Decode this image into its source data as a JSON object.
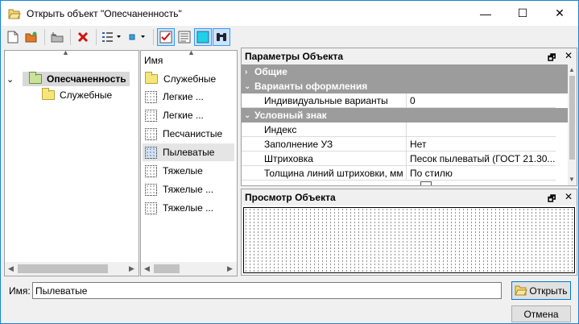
{
  "window": {
    "title": "Открыть объект \"Опесчаненность\"",
    "minimize_glyph": "—",
    "maximize_glyph": "☐",
    "close_glyph": "✕"
  },
  "toolbar": {
    "buttons": [
      {
        "name": "new-doc-icon"
      },
      {
        "name": "open-folder-icon"
      },
      {
        "name": "back-folder-icon"
      },
      {
        "name": "delete-icon"
      },
      {
        "name": "view-list-icon"
      },
      {
        "name": "view-small-icon"
      },
      {
        "name": "checked-icon"
      },
      {
        "name": "properties-icon"
      },
      {
        "name": "preview-icon"
      },
      {
        "name": "binoculars-icon"
      }
    ]
  },
  "tree": {
    "root": "Опесчаненность",
    "child": "Служебные",
    "expander": "⌄"
  },
  "list": {
    "header": "Имя",
    "items": [
      {
        "label": "Служебные",
        "type": "folder"
      },
      {
        "label": "Легкие ...",
        "type": "pattern"
      },
      {
        "label": "Легкие ...",
        "type": "pattern"
      },
      {
        "label": "Песчанистые",
        "type": "pattern"
      },
      {
        "label": "Пылеватые",
        "type": "pattern-selected"
      },
      {
        "label": "Тяжелые",
        "type": "pattern"
      },
      {
        "label": "Тяжелые ...",
        "type": "pattern"
      },
      {
        "label": "Тяжелые ...",
        "type": "pattern"
      }
    ]
  },
  "properties": {
    "title": "Параметры Объекта",
    "categories": {
      "general": "Общие",
      "variants": "Варианты оформления",
      "symbol": "Условный знак"
    },
    "rows": {
      "individual": {
        "key": "Индивидуальные варианты",
        "value": "0"
      },
      "index": {
        "key": "Индекс",
        "value": ""
      },
      "fill": {
        "key": "Заполнение УЗ",
        "value": "Нет"
      },
      "hatch": {
        "key": "Штриховка",
        "value": "Песок пылеватый (ГОСТ 21.30..."
      },
      "thickness": {
        "key": "Толщина линий штриховки, мм",
        "value": "По стилю"
      }
    }
  },
  "preview": {
    "title": "Просмотр Объекта"
  },
  "footer": {
    "name_label": "Имя:",
    "name_value": "Пылеватые",
    "open_label": "Открыть",
    "cancel_label": "Отмена"
  }
}
